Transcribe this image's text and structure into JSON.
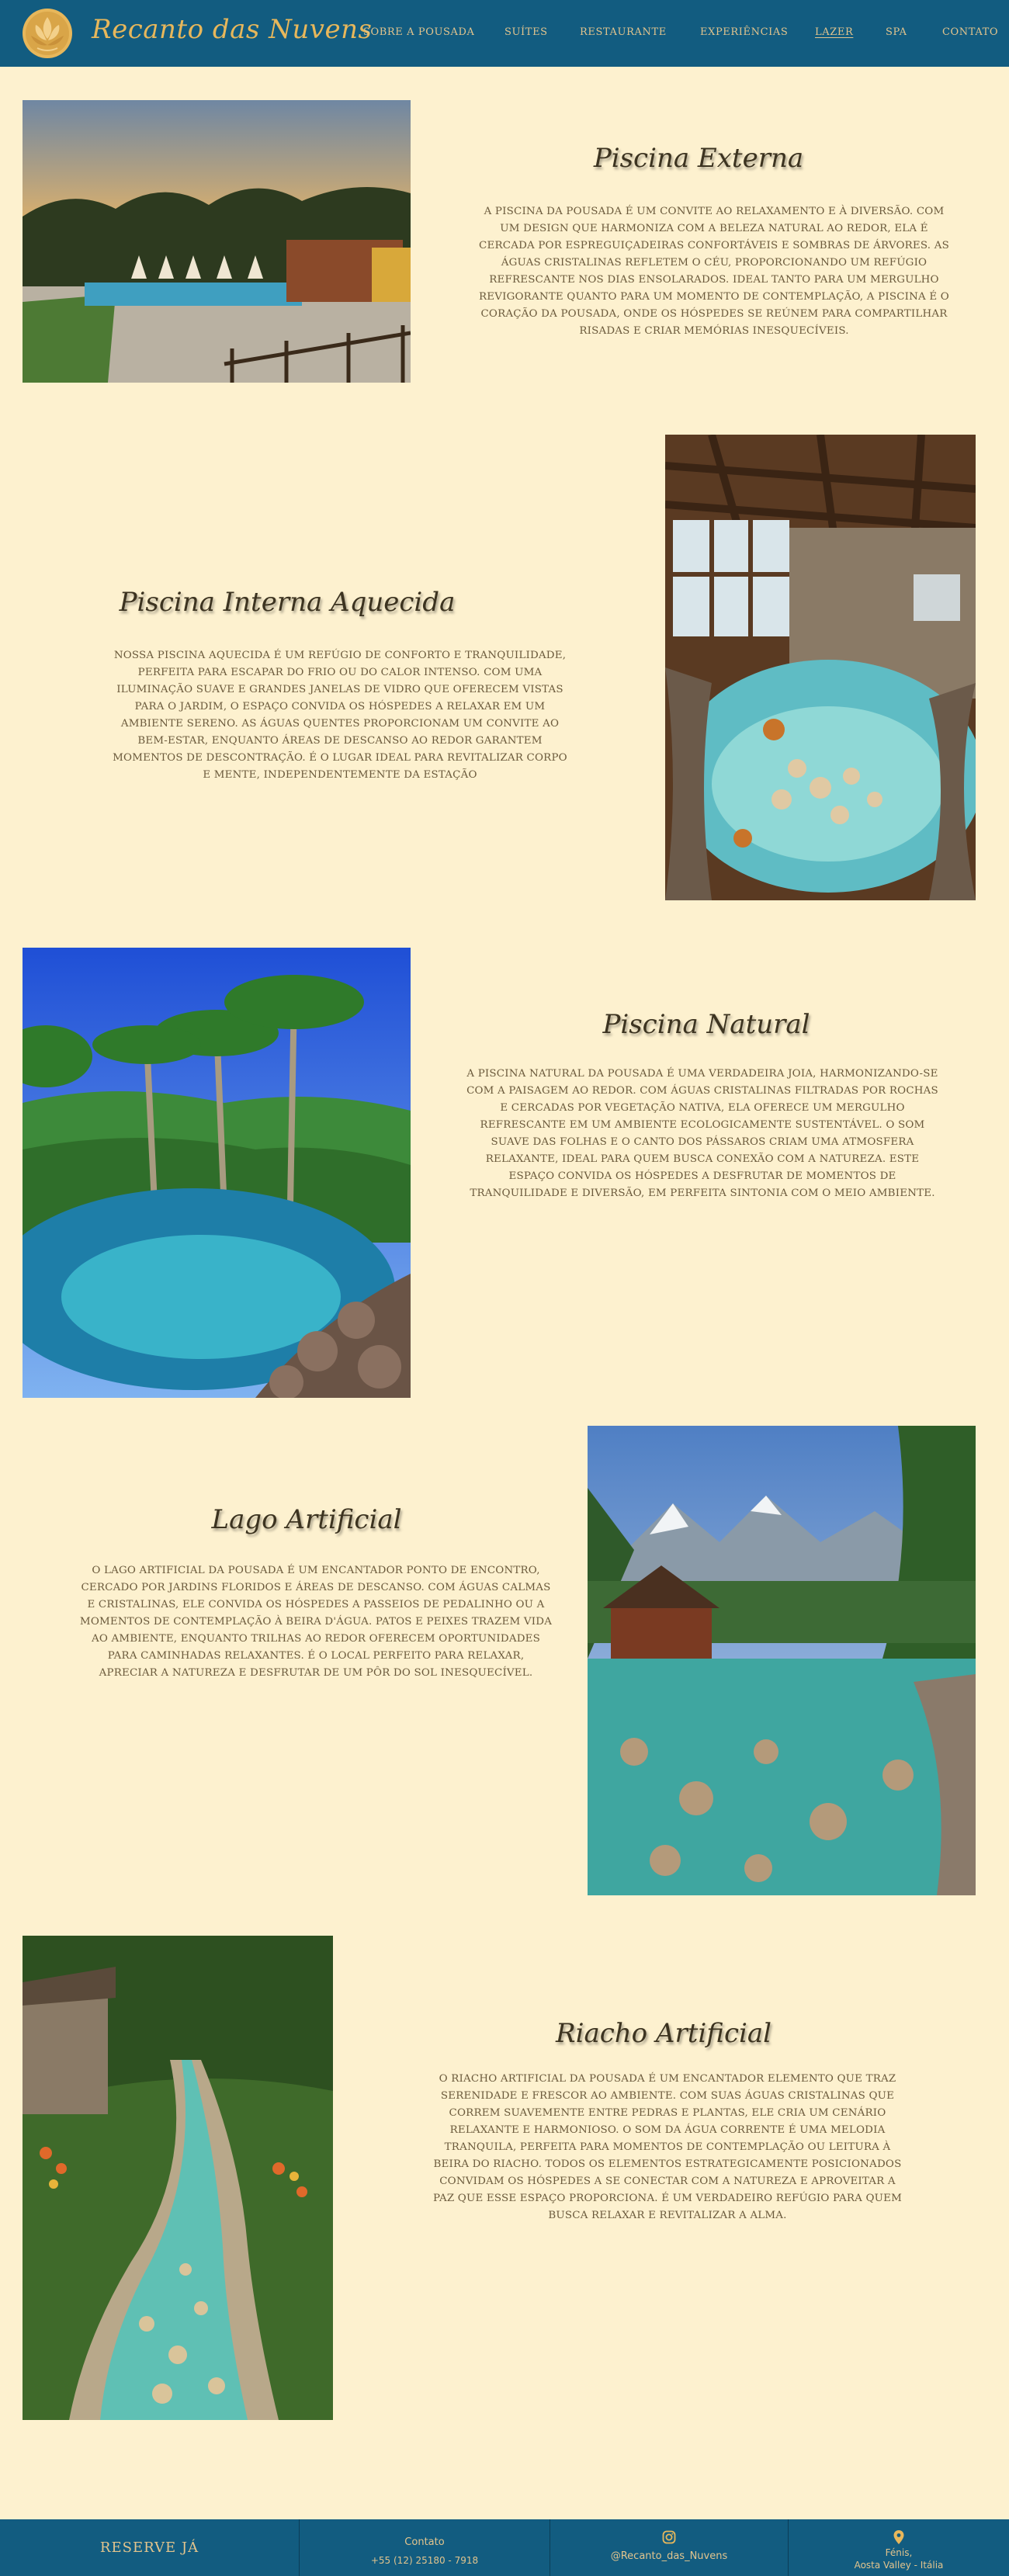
{
  "header": {
    "brand": "Recanto das Nuvens",
    "nav": [
      {
        "label": "Sobre a Pousada",
        "active": false
      },
      {
        "label": "Suítes",
        "active": false
      },
      {
        "label": "Restaurante",
        "active": false
      },
      {
        "label": "Experiências",
        "active": false
      },
      {
        "label": "Lazer",
        "active": true
      },
      {
        "label": "Spa",
        "active": false
      },
      {
        "label": "Contato",
        "active": false
      }
    ]
  },
  "sections": [
    {
      "title": "Piscina Externa",
      "text": "A piscina da pousada é um convite ao relaxamento e à diversão. Com um design que harmoniza com a beleza natural ao redor, ela é cercada por espreguiçadeiras confortáveis e sombras de árvores. As águas cristalinas refletem o céu, proporcionando um refúgio refrescante nos dias ensolarados. Ideal tanto para um mergulho revigorante quanto para um momento de contemplação, a piscina é o coração da pousada, onde os hóspedes se reúnem para compartilhar risadas e criar memórias inesquecíveis."
    },
    {
      "title": "Piscina Interna Aquecida",
      "text": "Nossa piscina aquecida é um refúgio de conforto e tranquilidade, perfeita para escapar do frio ou do calor intenso. Com uma iluminação suave e grandes janelas de vidro que oferecem vistas para o jardim, o espaço convida os hóspedes a relaxar em um ambiente sereno. As águas quentes proporcionam um convite ao bem-estar, enquanto áreas de descanso ao redor garantem momentos de descontração. É o lugar ideal para revitalizar corpo e mente, independentemente da estação"
    },
    {
      "title": "Piscina Natural",
      "text": "A piscina natural da pousada é uma verdadeira joia, harmonizando-se com a paisagem ao redor. Com águas cristalinas filtradas por rochas e cercadas por vegetação nativa, ela oferece um mergulho refrescante em um ambiente ecologicamente sustentável. O som suave das folhas e o canto dos pássaros criam uma atmosfera relaxante, ideal para quem busca conexão com a natureza. Este espaço convida os hóspedes a desfrutar de momentos de tranquilidade e diversão, em perfeita sintonia com o meio ambiente."
    },
    {
      "title": "Lago Artificial",
      "text": "O lago artificial da pousada é um encantador ponto de encontro, cercado por jardins floridos e áreas de descanso. Com águas calmas e cristalinas, ele convida os hóspedes a passeios de pedalinho ou a momentos de contemplação à beira d'água. Patos e peixes trazem vida ao ambiente, enquanto trilhas ao redor oferecem oportunidades para caminhadas relaxantes. É o local perfeito para relaxar, apreciar a natureza e desfrutar de um pôr do sol inesquecível."
    },
    {
      "title": "Riacho Artificial",
      "text": "O riacho artificial da pousada é um encantador elemento que traz serenidade e frescor ao ambiente. Com suas águas cristalinas que correm suavemente entre pedras e plantas, ele cria um cenário relaxante e harmonioso. O som da água corrente é uma melodia tranquila, perfeita para momentos de contemplação ou leitura à beira do riacho. Todos os elementos estrategicamente posicionados convidam os hóspedes a se conectar com a natureza e aproveitar a paz que esse espaço proporciona. É um verdadeiro refúgio para quem busca relaxar e revitalizar a alma."
    }
  ],
  "footer": {
    "reserve": "RESERVE JÁ",
    "contact_label": "Contato",
    "phone": "+55 (12) 25180 - 7918",
    "instagram": "@Recanto_das_Nuvens",
    "location_line1": "Fénis,",
    "location_line2": "Aosta Valley - Itália"
  },
  "colors": {
    "background": "#fdf1cf",
    "header": "#125c80",
    "accent": "#e2c48d",
    "title": "#3c3320",
    "body_text": "#6b5a3c"
  },
  "icons": [
    "lotus-logo-icon",
    "instagram-icon",
    "location-pin-icon"
  ]
}
